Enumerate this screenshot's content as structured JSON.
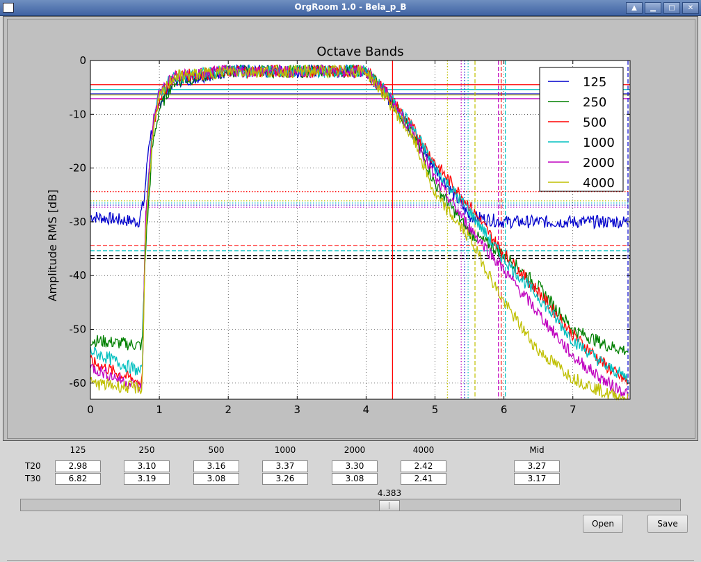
{
  "window": {
    "title": "OrgRoom 1.0 - Bela_p_B"
  },
  "chart_data": {
    "type": "line",
    "title": "Octave Bands",
    "xlabel": "",
    "ylabel": "Amplitude RMS [dB]",
    "xlim": [
      0,
      7.83
    ],
    "ylim": [
      -63,
      0
    ],
    "xticks": [
      "0",
      "1",
      "2",
      "3",
      "4",
      "5",
      "6",
      "7"
    ],
    "yticks": [
      "0",
      "-10",
      "-20",
      "-30",
      "-40",
      "-50",
      "-60"
    ],
    "grid": true,
    "legend": "top-right",
    "cursor_x": 4.383,
    "series": [
      {
        "name": "125",
        "color": "#0000cc",
        "x": [
          0,
          0.7,
          0.78,
          0.85,
          1.0,
          1.2,
          2.0,
          3.0,
          4.0,
          4.2,
          4.5,
          5.0,
          5.5,
          6.0,
          6.5,
          7.0,
          7.8
        ],
        "y": [
          -29,
          -30,
          -26,
          -15,
          -8,
          -4,
          -2,
          -2,
          -2,
          -5,
          -10,
          -20,
          -29,
          -30,
          -30,
          -30,
          -30
        ]
      },
      {
        "name": "250",
        "color": "#008000",
        "x": [
          0,
          0.75,
          0.8,
          0.9,
          1.0,
          1.2,
          2.0,
          3.0,
          4.0,
          4.3,
          4.7,
          5.0,
          5.5,
          6.0,
          6.5,
          7.0,
          7.5,
          7.8
        ],
        "y": [
          -52,
          -53,
          -35,
          -16,
          -9,
          -4,
          -2,
          -2,
          -2,
          -6,
          -14,
          -23,
          -32,
          -36,
          -42,
          -50,
          -53,
          -54
        ]
      },
      {
        "name": "500",
        "color": "#ff0000",
        "x": [
          0,
          0.75,
          0.8,
          0.9,
          1.0,
          1.2,
          2.0,
          3.0,
          4.0,
          4.3,
          4.7,
          5.0,
          5.5,
          6.0,
          6.5,
          7.0,
          7.5,
          7.8
        ],
        "y": [
          -56,
          -60,
          -30,
          -13,
          -7,
          -3,
          -2,
          -2,
          -2,
          -6,
          -13,
          -19,
          -27,
          -36,
          -43,
          -51,
          -57,
          -60
        ]
      },
      {
        "name": "1000",
        "color": "#00bfbf",
        "x": [
          0,
          0.75,
          0.8,
          0.9,
          1.0,
          1.2,
          2.0,
          3.0,
          4.0,
          4.3,
          4.7,
          5.0,
          5.5,
          6.0,
          6.5,
          7.0,
          7.5,
          7.8
        ],
        "y": [
          -54,
          -58,
          -30,
          -12,
          -6,
          -3,
          -2,
          -2,
          -2,
          -6,
          -13,
          -20,
          -28,
          -37,
          -44,
          -52,
          -57,
          -59
        ]
      },
      {
        "name": "2000",
        "color": "#bf00bf",
        "x": [
          0,
          0.75,
          0.8,
          0.9,
          1.0,
          1.2,
          2.0,
          3.0,
          4.0,
          4.3,
          4.7,
          5.0,
          5.5,
          6.0,
          6.5,
          7.0,
          7.5,
          7.8
        ],
        "y": [
          -57,
          -61,
          -30,
          -12,
          -6,
          -3,
          -2,
          -2,
          -2,
          -6,
          -14,
          -22,
          -31,
          -39,
          -47,
          -55,
          -60,
          -62
        ]
      },
      {
        "name": "4000",
        "color": "#bfbf00",
        "x": [
          0,
          0.75,
          0.8,
          0.9,
          1.0,
          1.2,
          2.0,
          3.0,
          4.0,
          4.3,
          4.7,
          5.0,
          5.5,
          6.0,
          6.5,
          7.0,
          7.5,
          7.8
        ],
        "y": [
          -60,
          -61,
          -32,
          -14,
          -7,
          -3,
          -2,
          -2,
          -2,
          -7,
          -15,
          -25,
          -33,
          -45,
          -54,
          -59,
          -62,
          -63
        ]
      }
    ],
    "hlines": [
      {
        "y": -4.5,
        "color": "#ff0000",
        "style": "solid"
      },
      {
        "y": -5.4,
        "color": "#00bfbf",
        "style": "solid"
      },
      {
        "y": -6.2,
        "color": "#0000cc",
        "style": "solid"
      },
      {
        "y": -6.4,
        "color": "#bfbf00",
        "style": "solid"
      },
      {
        "y": -7.1,
        "color": "#bf00bf",
        "style": "solid"
      },
      {
        "y": -24.4,
        "color": "#ff0000",
        "style": "dotted"
      },
      {
        "y": -26.1,
        "color": "#bfbf00",
        "style": "dotted"
      },
      {
        "y": -26.5,
        "color": "#00bfbf",
        "style": "dotted"
      },
      {
        "y": -26.9,
        "color": "#0000cc",
        "style": "dotted"
      },
      {
        "y": -27.3,
        "color": "#bf00bf",
        "style": "dotted"
      },
      {
        "y": -34.4,
        "color": "#ff0000",
        "style": "dashed"
      },
      {
        "y": -35.4,
        "color": "#00bfbf",
        "style": "dashed"
      },
      {
        "y": -36.3,
        "color": "#000000",
        "style": "dashed"
      },
      {
        "y": -36.8,
        "color": "#000000",
        "style": "dashed"
      }
    ],
    "vlines": [
      {
        "x": 4.383,
        "color": "#ff0000",
        "style": "solid"
      },
      {
        "x": 5.18,
        "color": "#bfbf00",
        "style": "dotted"
      },
      {
        "x": 5.38,
        "color": "#bf00bf",
        "style": "dotted"
      },
      {
        "x": 5.43,
        "color": "#0000cc",
        "style": "dotted"
      },
      {
        "x": 5.48,
        "color": "#00bfbf",
        "style": "dotted"
      },
      {
        "x": 5.58,
        "color": "#bfbf00",
        "style": "dashed"
      },
      {
        "x": 5.92,
        "color": "#bf00bf",
        "style": "dashed"
      },
      {
        "x": 5.96,
        "color": "#ff0000",
        "style": "dashed"
      },
      {
        "x": 6.02,
        "color": "#00bfbf",
        "style": "dashed"
      },
      {
        "x": 7.8,
        "color": "#0000cc",
        "style": "dashed"
      }
    ]
  },
  "results": {
    "bands": [
      "125",
      "250",
      "500",
      "1000",
      "2000",
      "4000"
    ],
    "mid_label": "Mid",
    "rows": [
      {
        "label": "T20",
        "values": [
          "2.98",
          "3.10",
          "3.16",
          "3.37",
          "3.30",
          "2.42"
        ],
        "mid": "3.27"
      },
      {
        "label": "T30",
        "values": [
          "6.82",
          "3.19",
          "3.08",
          "3.26",
          "3.08",
          "2.41"
        ],
        "mid": "3.17"
      }
    ]
  },
  "slider": {
    "value": "4.383"
  },
  "buttons": {
    "open": "Open",
    "save": "Save"
  }
}
